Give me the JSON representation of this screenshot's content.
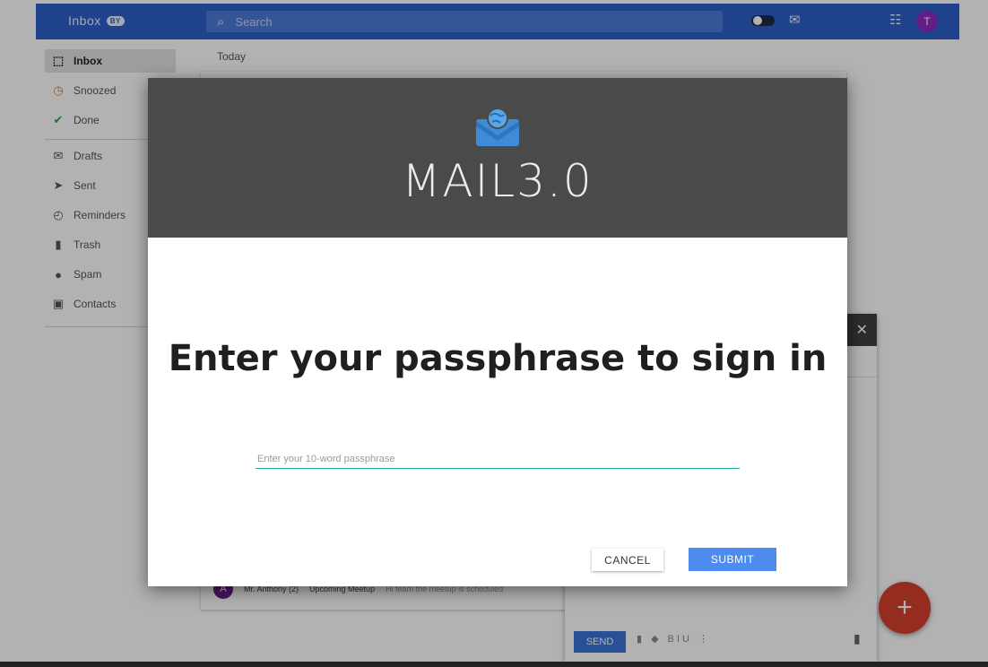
{
  "header": {
    "brand": "Inbox",
    "brand_badge": "BY",
    "search_placeholder": "Search",
    "avatar_letter": "T"
  },
  "sidebar": {
    "items": [
      {
        "label": "Inbox",
        "icon": "inbox-icon",
        "active": true
      },
      {
        "label": "Snoozed",
        "icon": "clock-icon"
      },
      {
        "label": "Done",
        "icon": "check-icon"
      },
      {
        "label": "Drafts",
        "icon": "drafts-icon"
      },
      {
        "label": "Sent",
        "icon": "send-icon"
      },
      {
        "label": "Reminders",
        "icon": "reminder-icon"
      },
      {
        "label": "Trash",
        "icon": "trash-icon"
      },
      {
        "label": "Spam",
        "icon": "spam-icon"
      },
      {
        "label": "Contacts",
        "icon": "contacts-icon"
      }
    ]
  },
  "main": {
    "section_label": "Today",
    "row": {
      "avatar": "A",
      "sender": "Mr. Anthony (2)",
      "subject": "Upcoming Meetup",
      "snippet": "Hi team the meetup is scheduled"
    }
  },
  "compose": {
    "send_label": "SEND"
  },
  "dialog": {
    "logo_text": "MAIL3.0",
    "title": "Enter your passphrase to sign in",
    "input_placeholder": "Enter your 10-word passphrase",
    "cancel_label": "CANCEL",
    "submit_label": "SUBMIT"
  },
  "colors": {
    "topbar": "#2b5fc8",
    "dialog_header": "#4a4a4a",
    "submit": "#4d8bee",
    "fab": "#d6402f",
    "input_underline": "#26a69a"
  }
}
